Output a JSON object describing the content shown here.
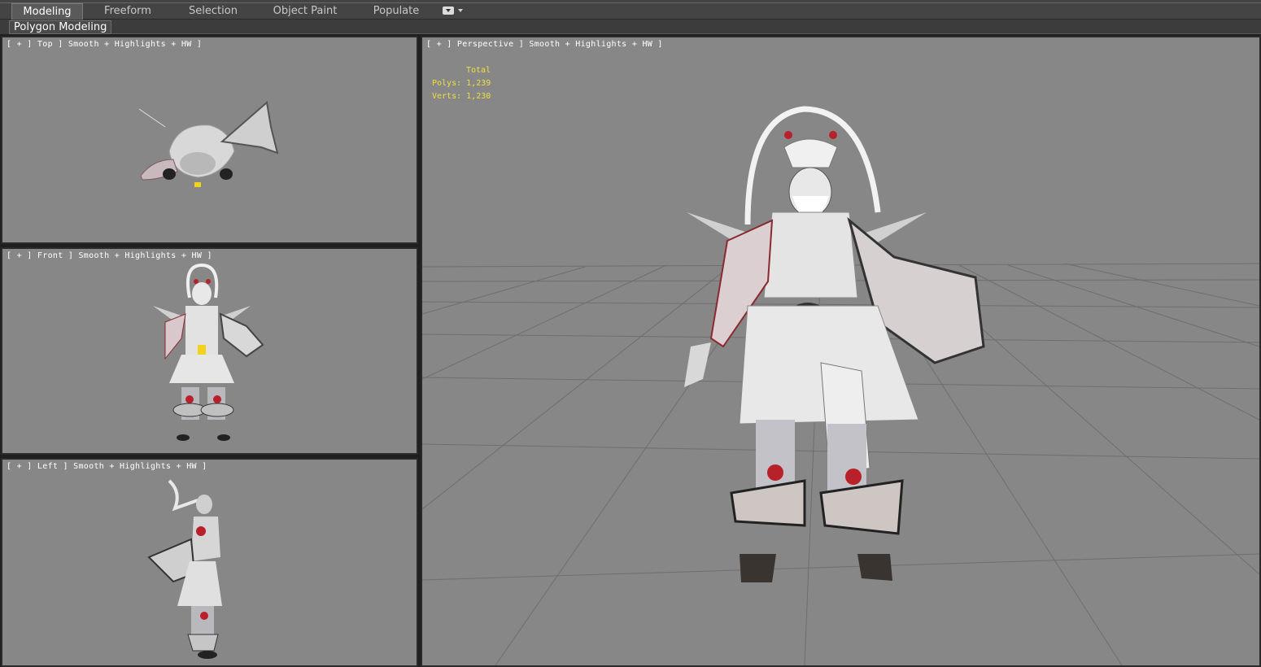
{
  "ribbon": {
    "tabs": [
      {
        "label": "Modeling",
        "active": true
      },
      {
        "label": "Freeform",
        "active": false
      },
      {
        "label": "Selection",
        "active": false
      },
      {
        "label": "Object Paint",
        "active": false
      },
      {
        "label": "Populate",
        "active": false
      }
    ],
    "dropdown_icon": "chevron-down-icon",
    "panel_label": "Polygon Modeling"
  },
  "viewports": {
    "top": {
      "label": "[ + ] Top ] Smooth + Highlights + HW ]"
    },
    "front": {
      "label": "[ + ] Front ] Smooth + Highlights + HW ]"
    },
    "left": {
      "label": "[ + ] Left ] Smooth + Highlights + HW ]"
    },
    "perspective": {
      "label": "[ + ] Perspective ] Smooth + Highlights + HW ]"
    }
  },
  "stats": {
    "total_label": "Total",
    "polys_label": "Polys:",
    "polys_value": "1,239",
    "verts_label": "Verts:",
    "verts_value": "1,230"
  },
  "colors": {
    "viewport_bg": "#878787",
    "stats_text": "#f0e040",
    "accent_yellow": "#f2d21b",
    "accent_red": "#b8202a"
  }
}
